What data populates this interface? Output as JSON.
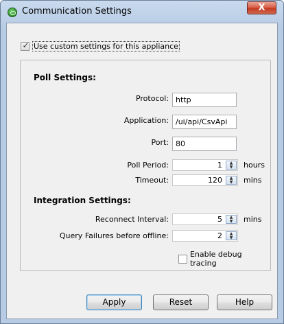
{
  "window": {
    "title": "Communication Settings",
    "close_label": "X"
  },
  "custom_settings": {
    "label": "Use custom settings for this appliance",
    "checked": true
  },
  "poll_settings": {
    "heading": "Poll Settings:",
    "protocol": {
      "label": "Protocol:",
      "value": "http"
    },
    "application": {
      "label": "Application:",
      "value": "/ui/api/CsvApi"
    },
    "port": {
      "label": "Port:",
      "value": "80"
    },
    "poll_period": {
      "label": "Poll Period:",
      "value": "1",
      "unit": "hours"
    },
    "timeout": {
      "label": "Timeout:",
      "value": "120",
      "unit": "mins"
    }
  },
  "integration_settings": {
    "heading": "Integration Settings:",
    "reconnect_interval": {
      "label": "Reconnect Interval:",
      "value": "5",
      "unit": "mins"
    },
    "query_failures": {
      "label": "Query Failures before offline:",
      "value": "2"
    }
  },
  "debug_tracing": {
    "label": "Enable debug tracing",
    "checked": false
  },
  "buttons": {
    "apply": "Apply",
    "reset": "Reset",
    "help": "Help"
  },
  "colors": {
    "title_bar": "#c9daee",
    "close_button": "#c23b22",
    "dialog_background": "#f0f0f0",
    "default_button_border": "#3c7fb1"
  }
}
